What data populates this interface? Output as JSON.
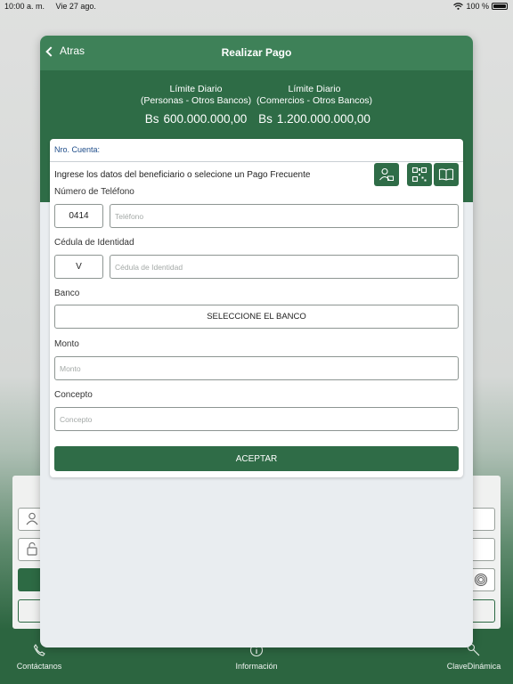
{
  "status_bar": {
    "time": "10:00 a. m.",
    "date": "Vie 27 ago.",
    "battery": "100 %"
  },
  "header": {
    "back_label": "Atras",
    "title": "Realizar Pago"
  },
  "limits": [
    {
      "line1": "Límite Diario",
      "line2": "(Personas - Otros Bancos)",
      "currency": "Bs",
      "amount": "600.000.000,00"
    },
    {
      "line1": "Límite Diario",
      "line2": "(Comercios - Otros Bancos)",
      "currency": "Bs",
      "amount": "1.200.000.000,00"
    }
  ],
  "form": {
    "account_label": "Nro. Cuenta:",
    "instructions": "Ingrese los datos del beneficiario o selecione un Pago Frecuente",
    "phone_label": "Número de Teléfono",
    "phone_prefix": "0414",
    "phone_placeholder": "Teléfono",
    "id_label": "Cédula de Identidad",
    "id_type": "V",
    "id_placeholder": "Cédula de Identidad",
    "bank_label": "Banco",
    "bank_select": "SELECCIONE EL BANCO",
    "amount_label": "Monto",
    "amount_placeholder": "Monto",
    "concept_label": "Concepto",
    "concept_placeholder": "Concepto",
    "accept_label": "ACEPTAR",
    "icons": [
      "contacts-icon",
      "qr-code-icon",
      "book-icon"
    ]
  },
  "bottom_nav": [
    {
      "label": "Contáctanos",
      "icon": "phone-icon"
    },
    {
      "label": "Información",
      "icon": "info-icon"
    },
    {
      "label": "ClaveDinámica",
      "icon": "key-icon"
    }
  ],
  "colors": {
    "header": "#3e8158",
    "band": "#2e6c46",
    "button": "#2f6c47",
    "account_label": "#1f4d8a"
  }
}
